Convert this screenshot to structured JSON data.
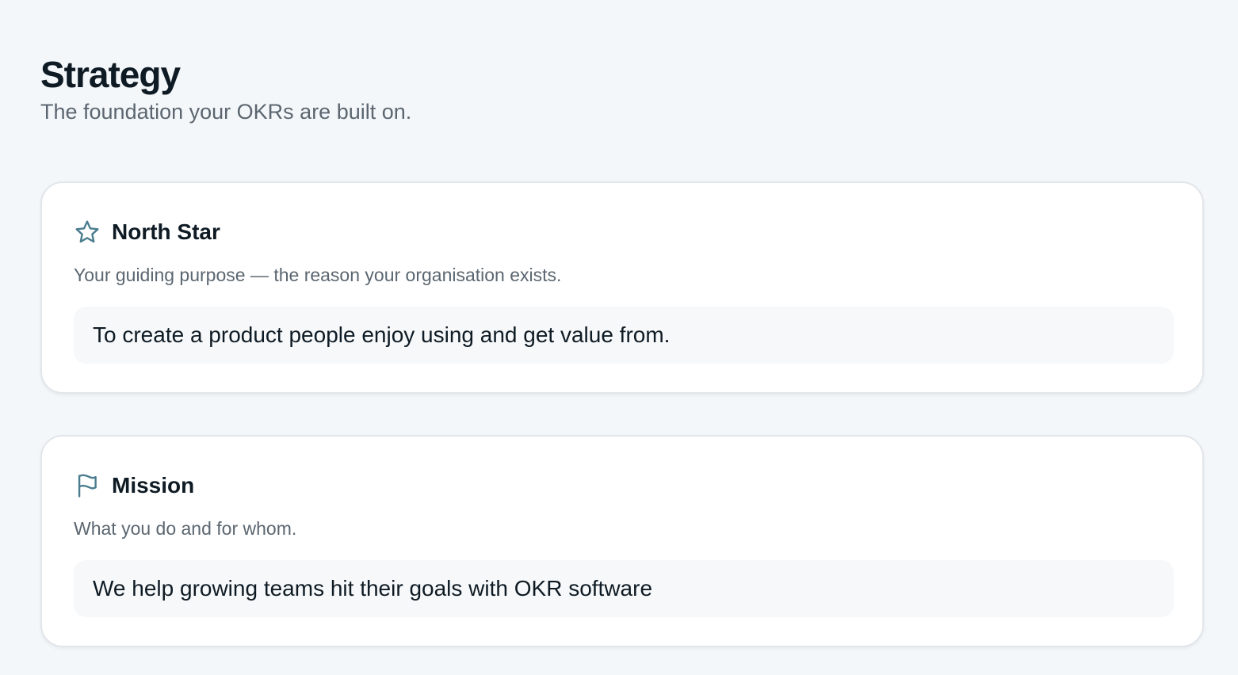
{
  "header": {
    "title": "Strategy",
    "subtitle": "The foundation your OKRs are built on."
  },
  "colors": {
    "page_background": "#f4f7fa",
    "card_background": "#ffffff",
    "value_background": "#f6f8fa",
    "icon_accent": "#4a7d8e",
    "title_text": "#0f1b24",
    "muted_text": "#5b6670"
  },
  "cards": {
    "north_star": {
      "icon": "star-icon",
      "title": "North Star",
      "description": "Your guiding purpose — the reason your organisation exists.",
      "value": "To create a product people enjoy using and get value from."
    },
    "mission": {
      "icon": "flag-icon",
      "title": "Mission",
      "description": "What you do and for whom.",
      "value": "We help growing teams hit their goals with OKR software"
    }
  }
}
